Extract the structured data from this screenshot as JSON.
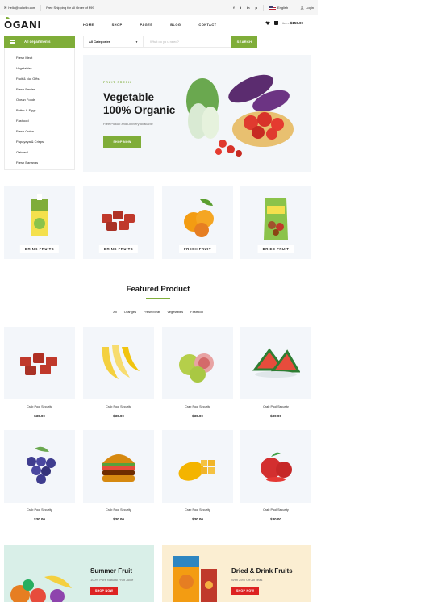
{
  "topbar": {
    "email": "hello@colorlib.com",
    "shipping": "Free Shipping for all Order of $99",
    "social": [
      "f",
      "t",
      "in",
      "p"
    ],
    "language": "English",
    "login": "Login"
  },
  "header": {
    "logo": "OGANI",
    "nav": [
      "HOME",
      "SHOP",
      "PAGES",
      "BLOG",
      "CONTACT"
    ],
    "item_label": "item:",
    "item_total": "$150.00"
  },
  "departments": {
    "button": "All departments",
    "items": [
      "Fresh Meat",
      "Vegetables",
      "Fruit & Nut Gifts",
      "Fresh Berries",
      "Ocean Foods",
      "Butter & Eggs",
      "Fastfood",
      "Fresh Onion",
      "Papayaya & Crisps",
      "Oatmeal",
      "Fresh Bananas"
    ]
  },
  "search": {
    "category": "All Categories",
    "placeholder": "What do yo u need?",
    "button": "SEARCH"
  },
  "hero": {
    "tag": "FRUIT FRESH",
    "title_line1": "Vegetable",
    "title_line2": "100% Organic",
    "subtitle": "Free Pickup and Delivery Available",
    "button": "SHOP NOW"
  },
  "categories": [
    "DRINK FRUITS",
    "DRINK FRUITS",
    "FRESH FRUIT",
    "DRIED FRUIT"
  ],
  "featured": {
    "title": "Featured Product",
    "filters": [
      "All",
      "Oranges",
      "Fresh Meat",
      "Vegetables",
      "Fastfood"
    ],
    "products": [
      {
        "name": "Crab Pool Security",
        "price": "$30.00",
        "icon": "meat-icon"
      },
      {
        "name": "Crab Pool Security",
        "price": "$30.00",
        "icon": "banana-icon"
      },
      {
        "name": "Crab Pool Security",
        "price": "$30.00",
        "icon": "guava-icon"
      },
      {
        "name": "Crab Pool Security",
        "price": "$30.00",
        "icon": "watermelon-icon"
      },
      {
        "name": "Crab Pool Security",
        "price": "$30.00",
        "icon": "grapes-icon"
      },
      {
        "name": "Crab Pool Security",
        "price": "$30.00",
        "icon": "burger-icon"
      },
      {
        "name": "Crab Pool Security",
        "price": "$30.00",
        "icon": "mango-icon"
      },
      {
        "name": "Crab Pool Security",
        "price": "$30.00",
        "icon": "apple-icon"
      }
    ]
  },
  "banners": [
    {
      "title": "Summer Fruit",
      "subtitle": "100% Pure Natural Fruit Juice",
      "button": "SHOP NOW"
    },
    {
      "title": "Dried & Drink Fruits",
      "subtitle": "With 25% Off All Teas",
      "button": "SHOP NOW"
    }
  ],
  "colors": {
    "accent": "#7fad39",
    "sale": "#dd2222",
    "card_bg": "#f3f6fa"
  }
}
